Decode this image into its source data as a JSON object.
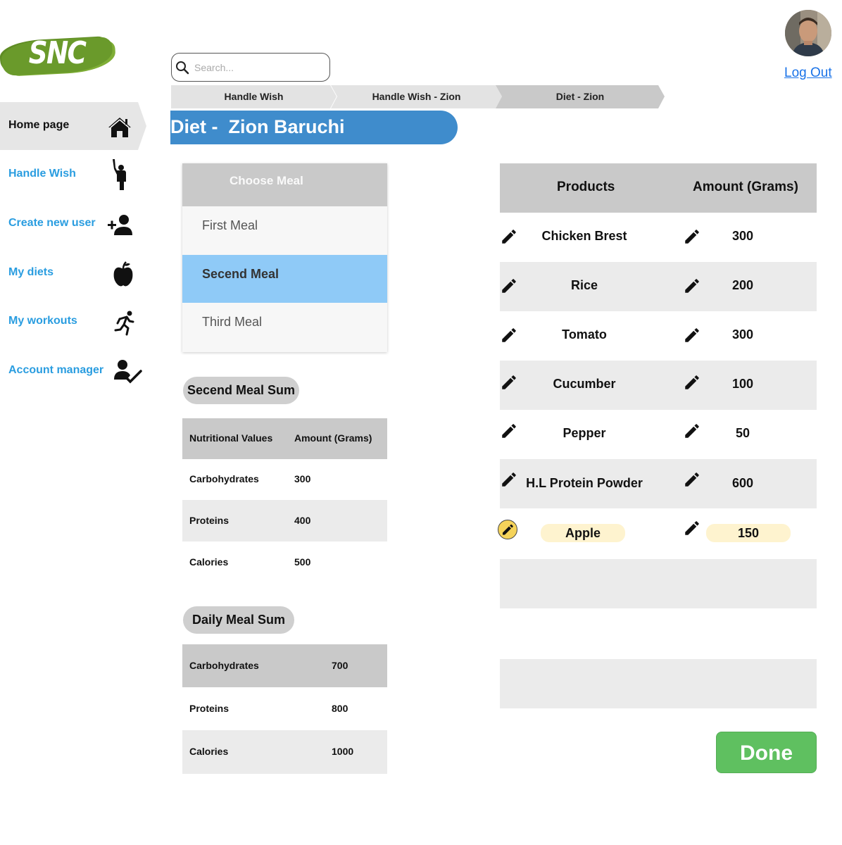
{
  "logo": {
    "text": "SNC",
    "color": "#6a9a2b"
  },
  "search": {
    "placeholder": "Search...",
    "value": "",
    "icon": "search-icon"
  },
  "user": {
    "logout_label": "Log Out"
  },
  "sidebar": {
    "items": [
      {
        "label": "Home page",
        "icon": "home-icon",
        "active": true
      },
      {
        "label": "Handle Wish",
        "icon": "hand-raise-icon"
      },
      {
        "label": "Create new user",
        "icon": "add-user-icon"
      },
      {
        "label": "My diets",
        "icon": "apple-icon"
      },
      {
        "label": "My workouts",
        "icon": "running-icon"
      },
      {
        "label": "Account manager",
        "icon": "user-check-icon"
      }
    ]
  },
  "breadcrumb": [
    "Handle Wish",
    "Handle Wish - Zion",
    "Diet - Zion"
  ],
  "page_title": "Diet -  Zion Baruchi",
  "meal_chooser": {
    "header": "Choose Meal",
    "meals": [
      "First Meal",
      "Secend Meal",
      "Third Meal"
    ],
    "selected": "Secend Meal"
  },
  "meal_sum": {
    "title": "Secend Meal Sum",
    "headers": [
      "Nutritional Values",
      "Amount (Grams)"
    ],
    "rows": [
      {
        "name": "Carbohydrates",
        "amount": "300"
      },
      {
        "name": "Proteins",
        "amount": "400"
      },
      {
        "name": "Calories",
        "amount": "500"
      }
    ]
  },
  "daily_sum": {
    "title": "Daily Meal Sum",
    "rows": [
      {
        "name": "Carbohydrates",
        "amount": "700"
      },
      {
        "name": "Proteins",
        "amount": "800"
      },
      {
        "name": "Calories",
        "amount": "1000"
      }
    ]
  },
  "products": {
    "headers": [
      "Products",
      "Amount (Grams)"
    ],
    "rows": [
      {
        "name": "Chicken Brest",
        "amount": "300"
      },
      {
        "name": "Rice",
        "amount": "200"
      },
      {
        "name": "Tomato",
        "amount": "300"
      },
      {
        "name": "Cucumber",
        "amount": "100"
      },
      {
        "name": "Pepper",
        "amount": "50"
      },
      {
        "name": "H.L Protein Powder",
        "amount": "600"
      },
      {
        "name": "Apple",
        "amount": "150",
        "highlighted": true
      }
    ]
  },
  "done_label": "Done",
  "colors": {
    "accent": "#3f8ccc",
    "link": "#2a9de0",
    "selected_meal": "#8fcaf7",
    "done": "#5fc060",
    "highlight": "#fef3cf"
  }
}
